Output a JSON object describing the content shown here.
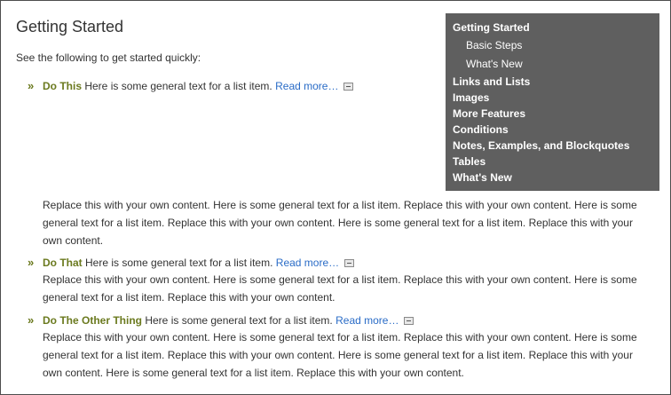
{
  "page": {
    "title": "Getting Started",
    "intro": "See the following to get started quickly:"
  },
  "toc": {
    "items": [
      {
        "label": "Getting Started"
      },
      {
        "label": "Basic Steps"
      },
      {
        "label": "What's New"
      },
      {
        "label": "Links and Lists"
      },
      {
        "label": "Images"
      },
      {
        "label": "More Features"
      },
      {
        "label": "Conditions"
      },
      {
        "label": "Notes, Examples, and Blockquotes"
      },
      {
        "label": "Tables"
      },
      {
        "label": "What's New"
      }
    ]
  },
  "list": {
    "bullet": "»",
    "items": [
      {
        "term": "Do This",
        "text": "Here is some general text for a list item.",
        "link": "Read more…",
        "body": "Replace this with your own content. Here is some general text for a list item. Replace this with your own content. Here is some general text for a list item. Replace this with your own content. Here is some general text for a list item. Replace this with your own content."
      },
      {
        "term": "Do That",
        "text": "Here is some general text for a list item.",
        "link": "Read more…",
        "body": "Replace this with your own content. Here is some general text for a list item. Replace this with your own content. Here is some general text for a list item. Replace this with your own content."
      },
      {
        "term": "Do The Other Thing",
        "text": "Here is some general text for a list item.",
        "link": "Read more…",
        "body": "Replace this with your own content. Here is some general text for a list item. Replace this with your own content. Here is some general text for a list item. Replace this with your own content. Here is some general text for a list item. Replace this with your own content. Here is some general text for a list item. Replace this with your own content."
      }
    ]
  }
}
